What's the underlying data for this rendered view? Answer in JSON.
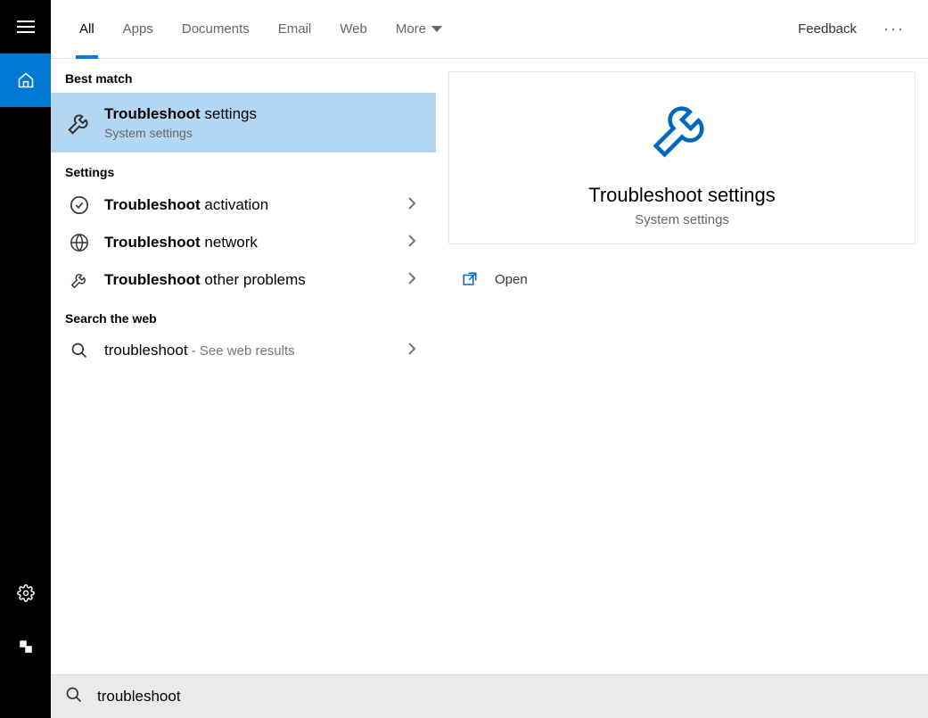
{
  "tabs": {
    "items": [
      {
        "label": "All",
        "active": true
      },
      {
        "label": "Apps",
        "active": false
      },
      {
        "label": "Documents",
        "active": false
      },
      {
        "label": "Email",
        "active": false
      },
      {
        "label": "Web",
        "active": false
      }
    ],
    "more": "More"
  },
  "feedback": "Feedback",
  "sections": {
    "best_match": "Best match",
    "settings": "Settings",
    "search_web": "Search the web"
  },
  "best_match_item": {
    "bold": "Troubleshoot",
    "rest": " settings",
    "sub": "System settings"
  },
  "settings_items": [
    {
      "bold": "Troubleshoot",
      "rest": " activation",
      "icon": "check"
    },
    {
      "bold": "Troubleshoot",
      "rest": " network",
      "icon": "globe"
    },
    {
      "bold": "Troubleshoot",
      "rest": " other problems",
      "icon": "wrench"
    }
  ],
  "web_item": {
    "query": "troubleshoot",
    "suffix": " - See web results"
  },
  "preview": {
    "title": "Troubleshoot settings",
    "sub": "System settings",
    "open": "Open"
  },
  "search": {
    "value": "troubleshoot"
  }
}
